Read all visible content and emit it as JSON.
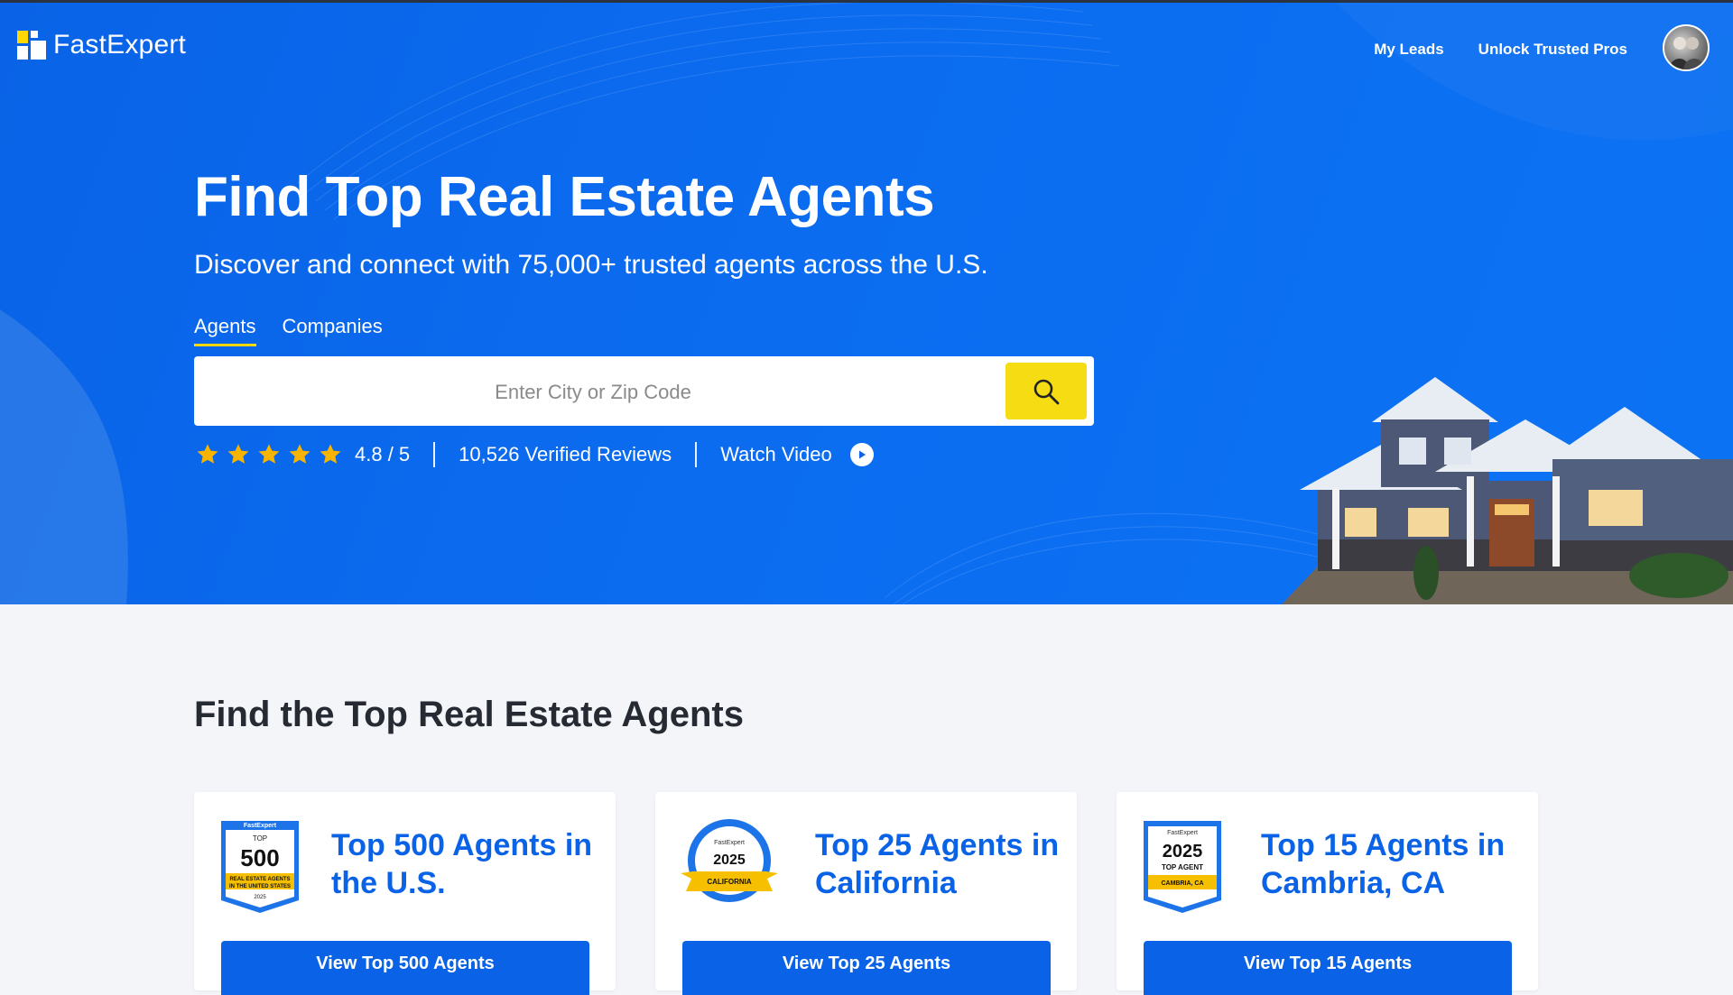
{
  "brand": {
    "name": "FastExpert"
  },
  "nav": {
    "my_leads": "My Leads",
    "unlock": "Unlock Trusted Pros"
  },
  "hero": {
    "title": "Find Top Real Estate Agents",
    "subtitle": "Discover and connect with 75,000+ trusted agents across the U.S.",
    "tabs": [
      {
        "label": "Agents",
        "active": true
      },
      {
        "label": "Companies",
        "active": false
      }
    ],
    "search_placeholder": "Enter City or Zip Code",
    "rating": "4.8 / 5",
    "rating_value": 4.8,
    "reviews": "10,526 Verified Reviews",
    "watch_video": "Watch Video"
  },
  "section": {
    "title": "Find the Top Real Estate Agents"
  },
  "cards": [
    {
      "title": "Top 500 Agents in the U.S.",
      "button": "View Top 500 Agents",
      "badge": {
        "brand": "FastExpert",
        "top": "TOP",
        "number": "500",
        "line1": "REAL ESTATE AGENTS",
        "line2": "IN THE UNITED STATES",
        "year": "2025"
      }
    },
    {
      "title": "Top 25 Agents in California",
      "button": "View Top 25 Agents",
      "badge": {
        "brand": "FastExpert",
        "year": "2025",
        "ribbon": "CALIFORNIA"
      }
    },
    {
      "title": "Top 15 Agents in Cambria, CA",
      "button": "View Top 15 Agents",
      "badge": {
        "brand": "FastExpert",
        "year": "2025",
        "label": "TOP AGENT",
        "ribbon": "CAMBRIA, CA"
      }
    }
  ],
  "colors": {
    "primary": "#0a63e6",
    "accent": "#f6dc12",
    "star": "#f8b400",
    "dark_text": "#252a33"
  }
}
